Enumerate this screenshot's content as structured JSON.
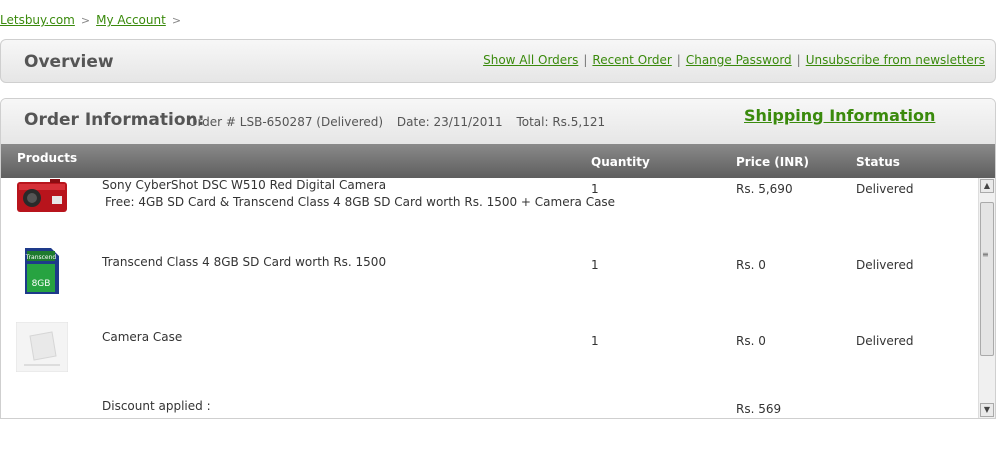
{
  "breadcrumb": {
    "home": "Letsbuy.com",
    "account": "My Account",
    "separator": ">"
  },
  "overview": {
    "title": "Overview",
    "links": [
      "Show All Orders",
      "Recent Order",
      "Change Password",
      "Unsubscribe from newsletters"
    ],
    "separator": "|"
  },
  "order": {
    "title": "Order Information:",
    "order_no": "Order # LSB-650287 (Delivered)",
    "date": "Date: 23/11/2011",
    "total": "Total: Rs.5,121",
    "shipping_link": "Shipping Information"
  },
  "columns": {
    "products": "Products",
    "quantity": "Quantity",
    "price": "Price (INR)",
    "status": "Status"
  },
  "items": [
    {
      "name": "Sony CyberShot DSC W510 Red Digital Camera",
      "free": "Free: 4GB SD Card & Transcend Class 4 8GB SD Card worth Rs. 1500 + Camera Case",
      "qty": "1",
      "price": "Rs. 5,690",
      "status": "Delivered",
      "icon": "red-camera-icon"
    },
    {
      "name": "Transcend Class 4 8GB SD Card worth Rs. 1500",
      "qty": "1",
      "price": "Rs. 0",
      "status": "Delivered",
      "icon": "sd-card-icon",
      "card_brand": "Transcend",
      "card_label": "8GB"
    },
    {
      "name": "Camera Case",
      "qty": "1",
      "price": "Rs. 0",
      "status": "Delivered",
      "icon": "camera-case-icon"
    }
  ],
  "discount": {
    "label": "Discount applied :",
    "price": "Rs. 569"
  },
  "colors": {
    "link": "#3a8a0c",
    "header_dark": "#5e5e5e"
  }
}
